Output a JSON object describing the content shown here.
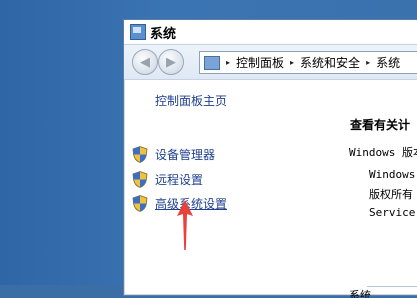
{
  "window": {
    "title": "系统"
  },
  "navbar": {
    "back_glyph": "◀",
    "forward_glyph": "▶",
    "address": {
      "crumbs": [
        "控制面板",
        "系统和安全",
        "系统"
      ],
      "separator": "▸"
    }
  },
  "sidebar": {
    "home_link": "控制面板主页",
    "tasks": [
      {
        "label": "设备管理器",
        "icon": "uac-shield-icon"
      },
      {
        "label": "远程设置",
        "icon": "uac-shield-icon"
      },
      {
        "label": "高级系统设置",
        "icon": "uac-shield-icon"
      }
    ]
  },
  "content": {
    "heading": "查看有关计",
    "windows_edition_label": "Windows 版本",
    "windows_line": "Windows",
    "copyright_line": "版权所有",
    "service_line": "Service",
    "system_label": "系统"
  },
  "colors": {
    "desktop": "#3a6ea5",
    "link": "#1f3f8f",
    "annotation_arrow": "#e8423a"
  }
}
